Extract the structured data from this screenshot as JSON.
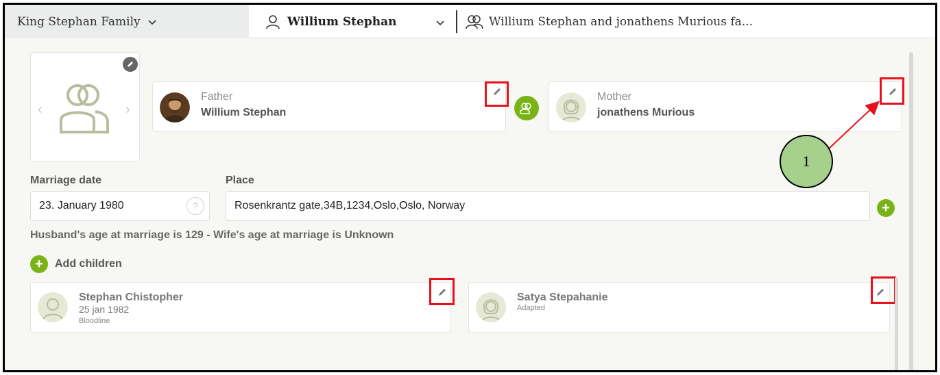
{
  "header": {
    "family_tab": "King Stephan Family",
    "person_tab": "Willium Stephan",
    "couple_tab": "Willium Stephan and jonathens Murious fa..."
  },
  "father": {
    "role": "Father",
    "name": "Willium Stephan"
  },
  "mother": {
    "role": "Mother",
    "name": "jonathens Murious"
  },
  "annotation": {
    "number": "1"
  },
  "marriage": {
    "date_label": "Marriage date",
    "date_value": "23. January 1980",
    "help": "?",
    "place_label": "Place",
    "place_value": "Rosenkrantz gate,34B,1234,Oslo,Oslo, Norway",
    "add": "+"
  },
  "age_info": "Husband's age at marriage is 129 - Wife's age at marriage is Unknown",
  "add_children": {
    "icon": "+",
    "label": "Add children"
  },
  "children": [
    {
      "name": "Stephan Chistopher",
      "date": "25 jan 1982",
      "tag": "Bloodline"
    },
    {
      "name": "Satya Stepahanie",
      "date": "",
      "tag": "Adapted"
    }
  ],
  "colors": {
    "accent": "#7ab317",
    "highlight": "#e8101a",
    "callout": "#a5d18c"
  }
}
